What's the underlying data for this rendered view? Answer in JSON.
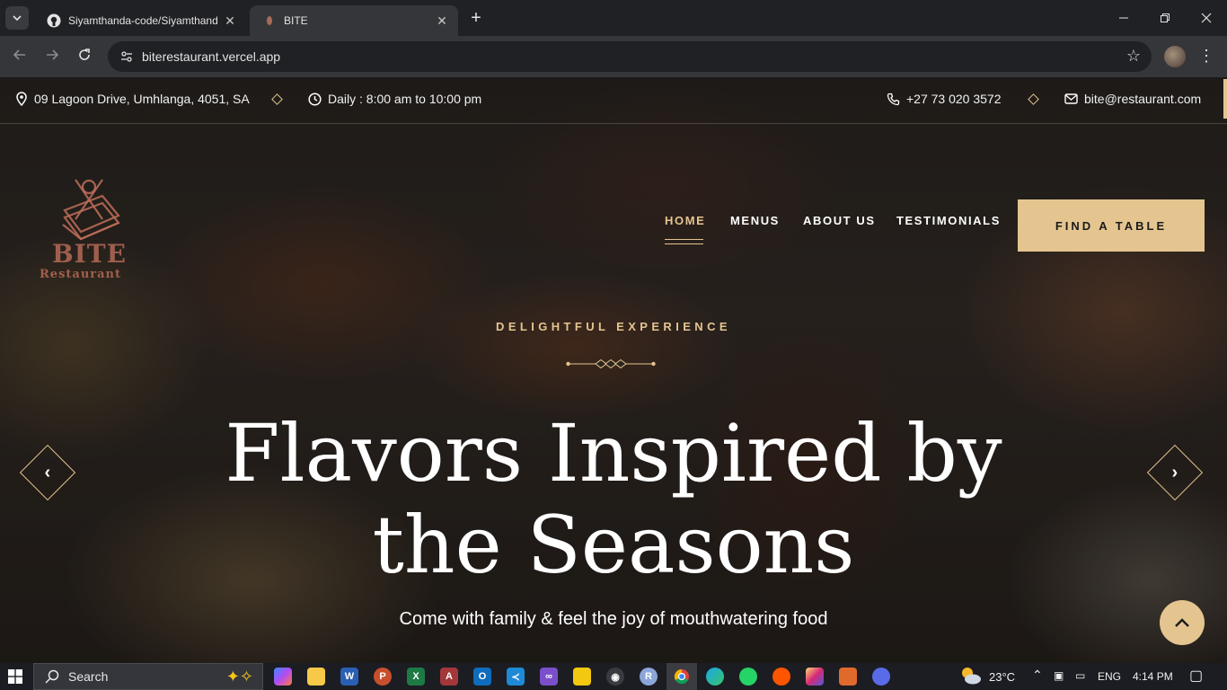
{
  "browser": {
    "tabs": [
      {
        "title": "Siyamthanda-code/Siyamthand",
        "favicon": "github-icon",
        "active": false
      },
      {
        "title": "BITE",
        "favicon": "bite-favicon",
        "active": true
      }
    ],
    "url": "biterestaurant.vercel.app"
  },
  "topbar": {
    "address": "09 Lagoon Drive, Umhlanga, 4051, SA",
    "hours": "Daily : 8:00 am to 10:00 pm",
    "phone": "+27 73 020 3572",
    "email": "bite@restaurant.com"
  },
  "logo": {
    "line1": "BITE",
    "line2": "Restaurant"
  },
  "nav": {
    "items": [
      {
        "label": "HOME",
        "active": true
      },
      {
        "label": "MENUS",
        "active": false
      },
      {
        "label": "ABOUT US",
        "active": false
      },
      {
        "label": "TESTIMONIALS",
        "active": false
      }
    ],
    "cta": "FIND A TABLE"
  },
  "hero": {
    "subtitle": "DELIGHTFUL EXPERIENCE",
    "headline_line1": "Flavors Inspired by",
    "headline_line2": "the Seasons",
    "tagline": "Come with family & feel the joy of mouthwatering food"
  },
  "colors": {
    "accent": "#e4c590",
    "text": "#ffffff"
  },
  "taskbar": {
    "search_placeholder": "Search",
    "weather": "23°C",
    "language": "ENG",
    "time": "4:14 PM",
    "apps": [
      "copilot-icon",
      "file-explorer-icon",
      "word-icon",
      "powerpoint-icon",
      "excel-icon",
      "access-icon",
      "outlook-icon",
      "vscode-icon",
      "visual-studio-icon",
      "power-bi-icon",
      "teams-icon",
      "r-icon",
      "chrome-icon",
      "edge-icon",
      "whatsapp-icon",
      "soundcloud-icon",
      "instagram-icon",
      "app-icon",
      "settings-icon"
    ]
  }
}
